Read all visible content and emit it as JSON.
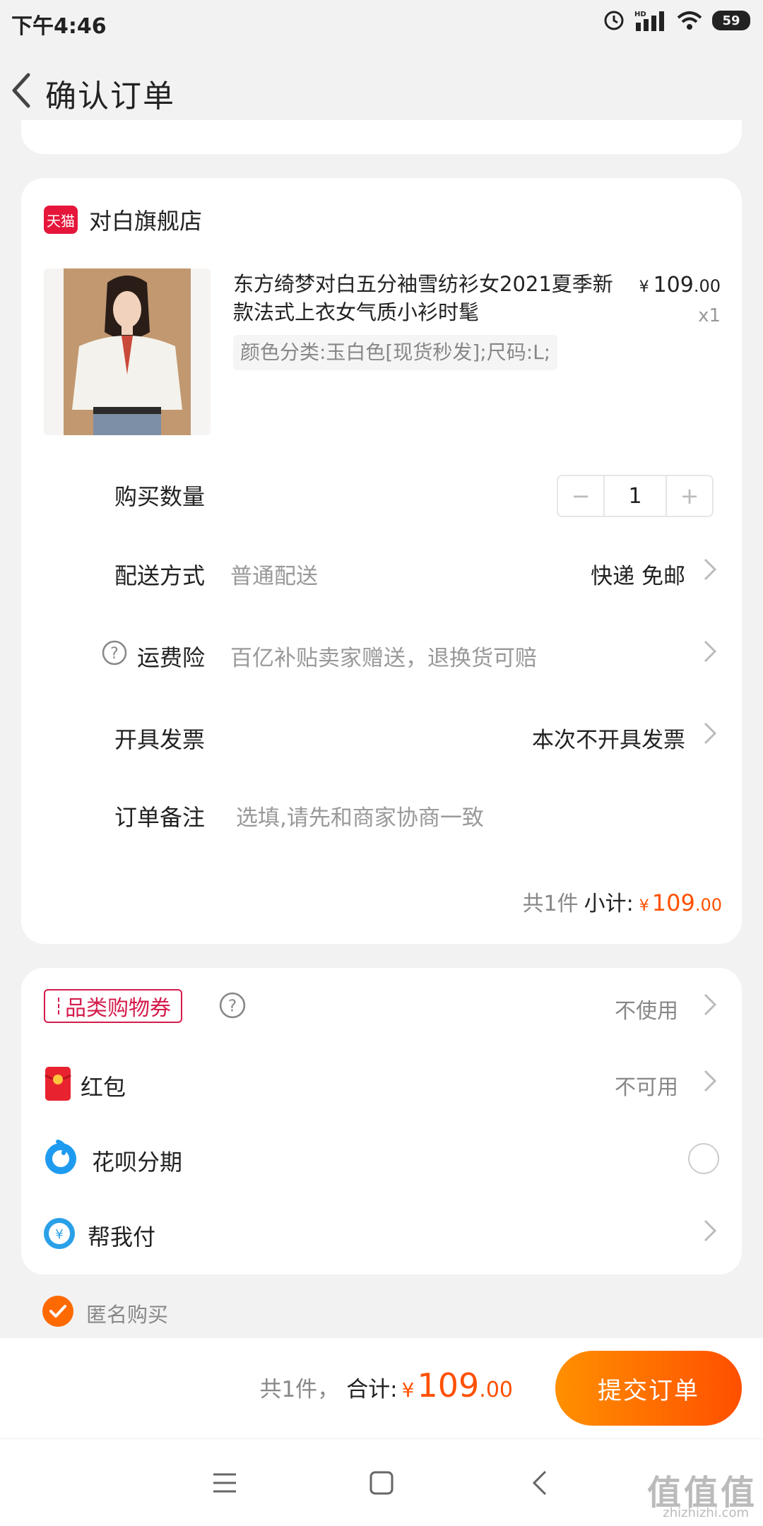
{
  "status_bar": {
    "time": "下午4:46",
    "hd_label": "HD",
    "battery": "59"
  },
  "header": {
    "title": "确认订单"
  },
  "store": {
    "badge": "天猫",
    "name": "对白旗舰店"
  },
  "product": {
    "title": "东方绮梦对白五分袖雪纺衫女2021夏季新款法式上衣女气质小衫时髦",
    "price_symbol": "¥",
    "price_int": "109",
    "price_dec": ".00",
    "quantity": "x1",
    "spec": "颜色分类:玉白色[现货秒发];尺码:L;"
  },
  "rows": {
    "qty_label": "购买数量",
    "qty_minus": "−",
    "qty_value": "1",
    "qty_plus": "+",
    "delivery_label": "配送方式",
    "delivery_sub": "普通配送",
    "delivery_value": "快递 免邮",
    "insurance_label": "运费险",
    "insurance_sub": "百亿补贴卖家赠送，退换货可赔",
    "invoice_label": "开具发票",
    "invoice_value": "本次不开具发票",
    "note_label": "订单备注",
    "note_placeholder": "选填,请先和商家协商一致"
  },
  "subtotal": {
    "count": "共1件",
    "label": "小计:",
    "symbol": "¥",
    "int": "109",
    "dec": ".00"
  },
  "payment": {
    "coupon_label": "品类购物券",
    "coupon_value": "不使用",
    "redpacket_label": "红包",
    "redpacket_value": "不可用",
    "huabei_label": "花呗分期",
    "helppay_label": "帮我付",
    "helppay_icon_text": "¥"
  },
  "anonymous": {
    "label": "匿名购买",
    "checked": true
  },
  "bottom": {
    "count": "共1件，",
    "total_label": "合计:",
    "symbol": "¥",
    "int": "109",
    "dec": ".00",
    "submit_label": "提交订单"
  },
  "watermark": {
    "main": "值值值",
    "sub": "zhizhizhi.com"
  },
  "colors": {
    "accent": "#ff5000",
    "coupon": "#d41c4b",
    "tmall": "#e6163b"
  }
}
